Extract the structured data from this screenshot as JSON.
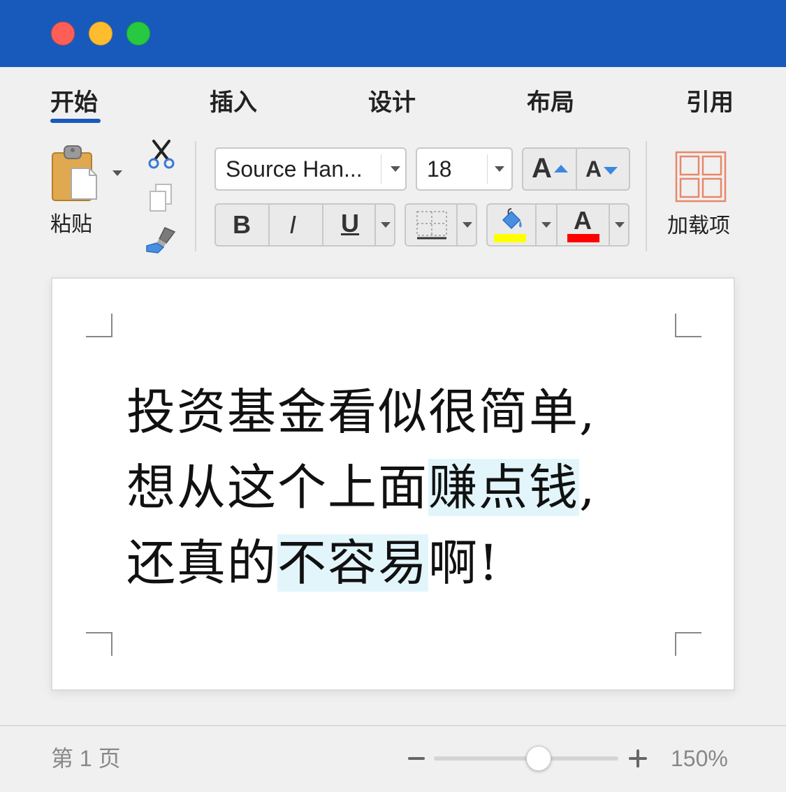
{
  "tabs": [
    {
      "label": "开始",
      "active": true
    },
    {
      "label": "插入"
    },
    {
      "label": "设计"
    },
    {
      "label": "布局"
    },
    {
      "label": "引用"
    }
  ],
  "clipboard": {
    "paste_label": "粘贴"
  },
  "font": {
    "family": "Source Han...",
    "size": "18"
  },
  "format_buttons": {
    "bold": "B",
    "italic": "I",
    "underline": "U",
    "grow": "A",
    "shrink": "A",
    "font_color": "A"
  },
  "addins": {
    "label": "加载项"
  },
  "colors": {
    "accent": "#185abc",
    "highlight": "#ffff00",
    "font_color": "#ff0000",
    "text_highlight_bg": "#e2f5fb"
  },
  "document": {
    "lines": [
      [
        {
          "text": "投资基金看似很简单,"
        }
      ],
      [
        {
          "text": "想从这个上面"
        },
        {
          "text": "赚点钱",
          "highlight": true
        },
        {
          "text": ","
        }
      ],
      [
        {
          "text": "还真的"
        },
        {
          "text": "不容易",
          "highlight": true
        },
        {
          "text": "啊!"
        }
      ]
    ]
  },
  "status": {
    "page": "第 1 页",
    "zoom": "150%",
    "zoom_slider_fraction": 0.5
  }
}
